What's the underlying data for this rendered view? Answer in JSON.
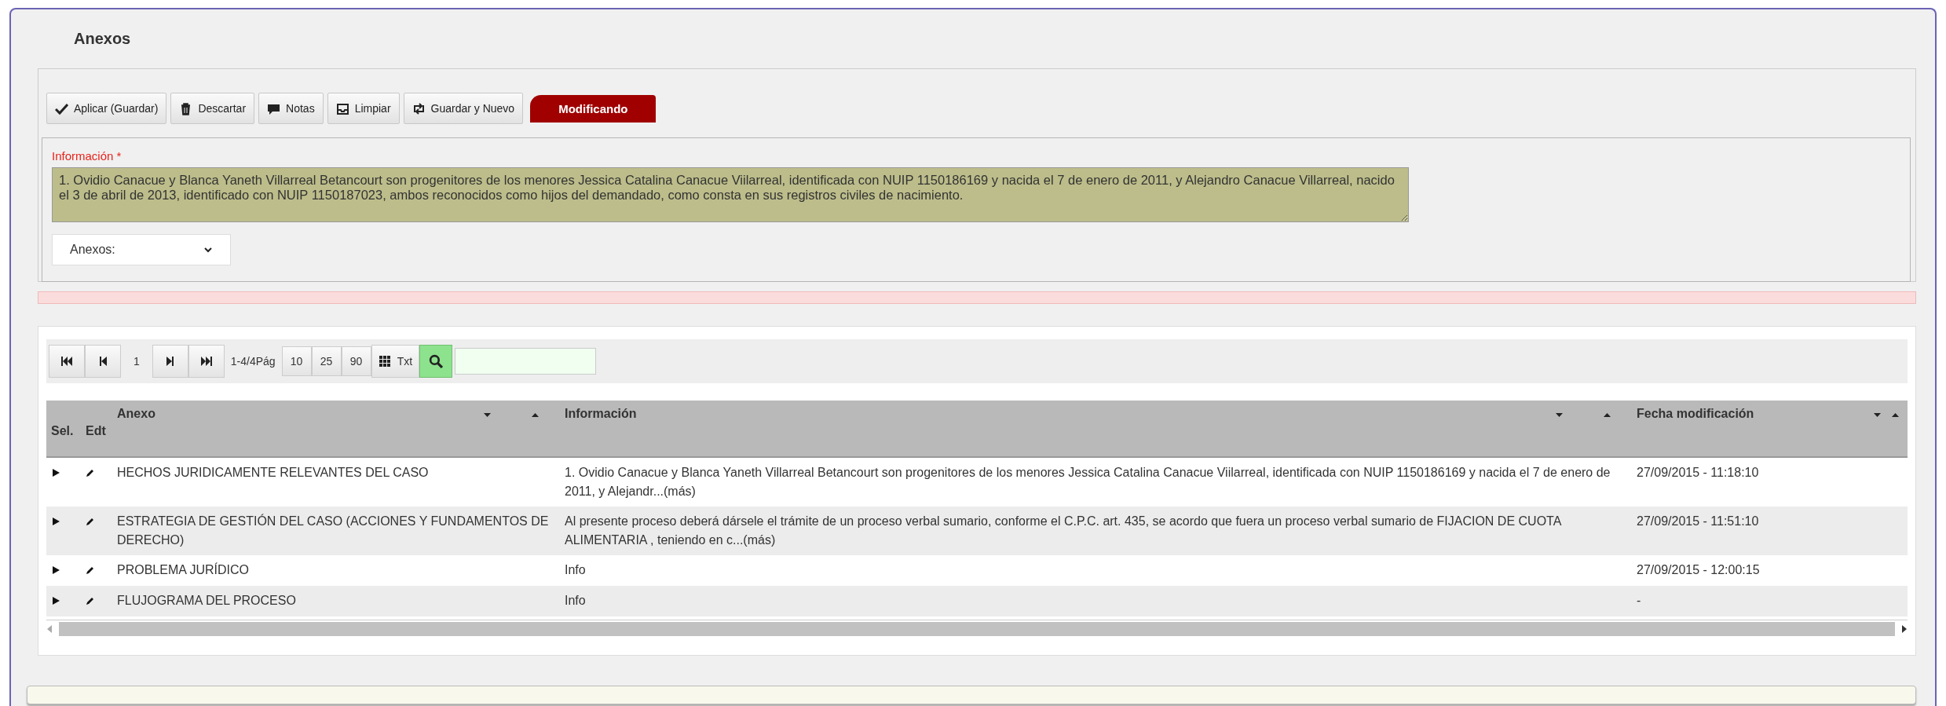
{
  "title": "Anexos",
  "toolbar": {
    "buttons": [
      {
        "kind": "check",
        "label": "Aplicar (Guardar)"
      },
      {
        "kind": "trash",
        "label": "Descartar"
      },
      {
        "kind": "comment",
        "label": "Notas"
      },
      {
        "kind": "inbox",
        "label": "Limpiar"
      },
      {
        "kind": "retweet",
        "label": "Guardar y Nuevo"
      }
    ],
    "status": "Modificando"
  },
  "informacion": {
    "label": "Información",
    "required_mark": "*",
    "value": "1. Ovidio Canacue y Blanca Yaneth Villarreal Betancourt son progenitores de los menores Jessica Catalina Canacue Viilarreal, identificada con NUIP 1150186169 y nacida el 7 de enero de 2011, y Alejandro Canacue Villarreal, nacido el 3 de abril de 2013, identificado con NUIP 1150187023, ambos reconocidos como hijos del demandado, como consta en sus registros civiles de nacimiento."
  },
  "annex_select": {
    "value": "Anexos:"
  },
  "grid": {
    "pager": {
      "page": "1",
      "range": "1-4/4Pág",
      "page_sizes": [
        "10",
        "25",
        "90"
      ],
      "text_button": "Txt"
    },
    "columns": [
      {
        "label": "Sel.",
        "sortable": false
      },
      {
        "label": "Edt",
        "sortable": false
      },
      {
        "label": "Anexo",
        "sortable": true
      },
      {
        "label": "Información",
        "sortable": true
      },
      {
        "label": "Fecha modificación",
        "sortable": true
      }
    ],
    "rows": [
      {
        "anexo": "HECHOS JURIDICAMENTE RELEVANTES DEL CASO",
        "informacion": "1. Ovidio Canacue y Blanca Yaneth Villarreal Betancourt son progenitores de los menores Jessica Catalina Canacue Viilarreal, identificada con NUIP 1150186169 y nacida el 7 de enero de 2011, y Alejandr...(más)",
        "fecha": "27/09/2015 - 11:18:10"
      },
      {
        "anexo": "ESTRATEGIA DE GESTIÓN DEL CASO (ACCIONES Y FUNDAMENTOS DE DERECHO)",
        "informacion": "Al presente proceso deberá dársele el trámite de un proceso verbal sumario, conforme el C.P.C. art. 435, se acordo que fuera un proceso verbal sumario de FIJACION DE CUOTA ALIMENTARIA , teniendo en c...(más)",
        "fecha": "27/09/2015 - 11:51:10"
      },
      {
        "anexo": "PROBLEMA JURÍDICO",
        "informacion": "Info",
        "fecha": "27/09/2015 - 12:00:15"
      },
      {
        "anexo": "FLUJOGRAMA DEL PROCESO",
        "informacion": "Info",
        "fecha": "-"
      }
    ]
  }
}
